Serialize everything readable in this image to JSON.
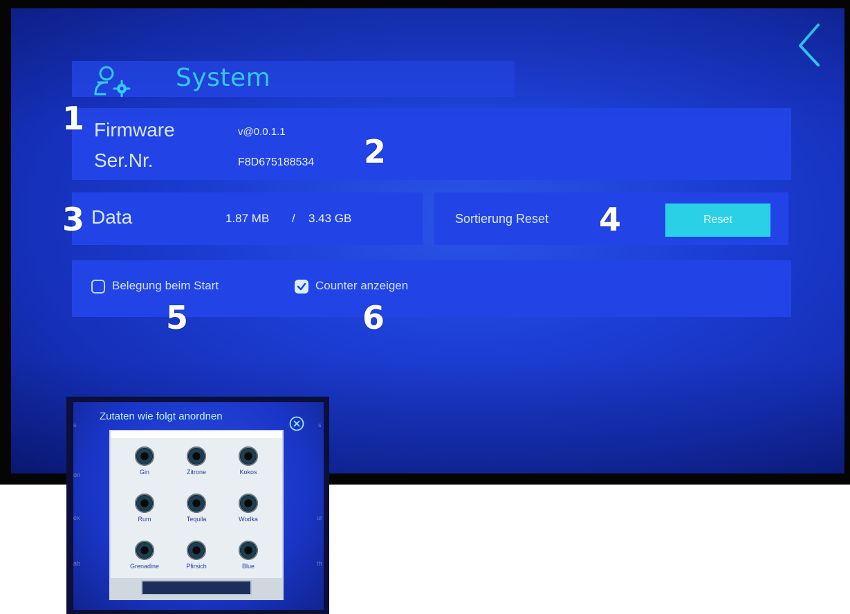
{
  "system": {
    "title": "System",
    "firmware_label": "Firmware",
    "firmware_value": "v@0.0.1.1",
    "serial_label": "Ser.Nr.",
    "serial_value": "F8D675188534",
    "data_label": "Data",
    "data_used": "1.87 MB",
    "data_sep": "/",
    "data_total": "3.43 GB",
    "reset_label": "Sortierung Reset",
    "reset_button": "Reset",
    "option1_label": "Belegung beim Start",
    "option1_checked": false,
    "option2_label": "Counter anzeigen",
    "option2_checked": true
  },
  "annotations": [
    "1",
    "2",
    "3",
    "4",
    "5",
    "6"
  ],
  "inset": {
    "title": "Zutaten wie folgt anordnen",
    "slots": [
      "Gin",
      "Zitrone",
      "Kokos",
      "Rum",
      "Tequila",
      "Wodka",
      "Grenadine",
      "Pfirsich",
      "Blue"
    ]
  },
  "colors": {
    "background": "#1d3fd6",
    "panel": "#2244e6",
    "title_accent": "#37d4ff",
    "reset_button": "#2ad0e6"
  },
  "icons": {
    "header": "user-gear-icon",
    "back": "chevron-left-icon",
    "close": "close-circle-icon"
  }
}
